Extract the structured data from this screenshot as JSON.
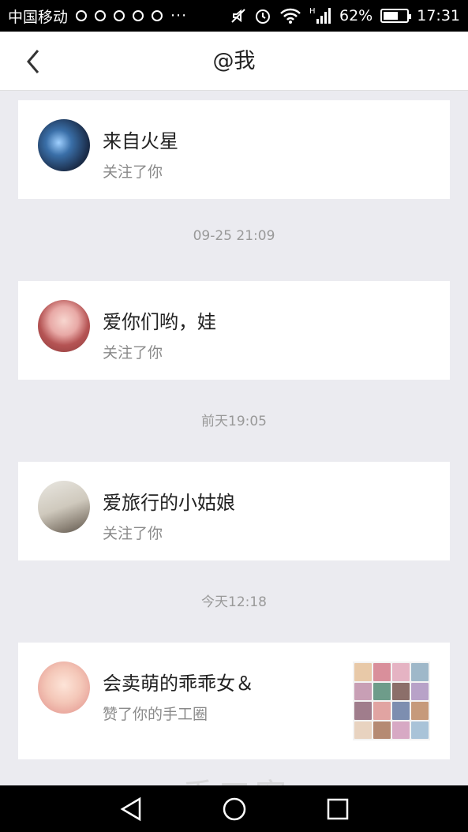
{
  "status_bar": {
    "carrier": "中国移动",
    "battery": "62%",
    "battery_level": 0.62,
    "time": "17:31"
  },
  "header": {
    "title": "@我"
  },
  "notifications": [
    {
      "name": "来自火星",
      "action": "关注了你"
    },
    {
      "name": "爱你们哟，娃",
      "action": "关注了你"
    },
    {
      "name": "爱旅行的小姑娘",
      "action": "关注了你"
    },
    {
      "name": "会卖萌的乖乖女＆",
      "action": "赞了你的手工圈"
    }
  ],
  "timestamps": [
    "09-25 21:09",
    "前天19:05",
    "今天12:18"
  ],
  "watermark": {
    "text": "手工客",
    "url": "shougongke.com"
  }
}
